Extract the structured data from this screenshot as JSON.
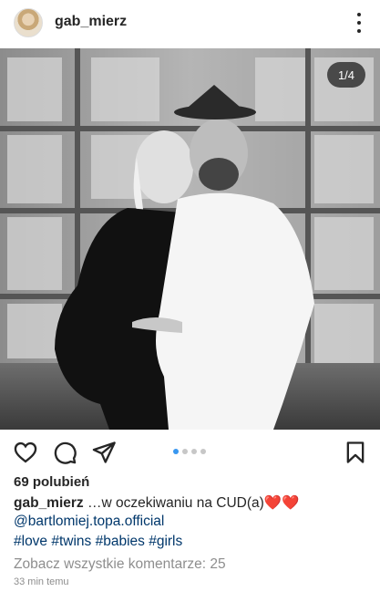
{
  "post": {
    "username": "gab_mierz",
    "avatar_icon": "profile-photo",
    "more_icon": "more-vertical-icon",
    "image_counter": "1/4",
    "carousel": {
      "count": 4,
      "active": 1
    },
    "likes": "69 polubień",
    "caption_username": "gab_mierz",
    "caption_text": " …w oczekiwaniu na CUD(a)❤️❤️",
    "mention": "@bartlomiej.topa.official",
    "hashtags": "#love #twins #babies #girls",
    "view_comments": "Zobacz wszystkie komentarze: 25",
    "timestamp": "33 min temu"
  },
  "colors": {
    "text": "#262626",
    "link": "#00376b",
    "muted": "#8e8e8e",
    "dot_active": "#3897f0",
    "dot_inactive": "#c7c7c7"
  },
  "icons": {
    "like": "heart-icon",
    "comment": "comment-icon",
    "share": "send-icon",
    "save": "bookmark-icon"
  }
}
